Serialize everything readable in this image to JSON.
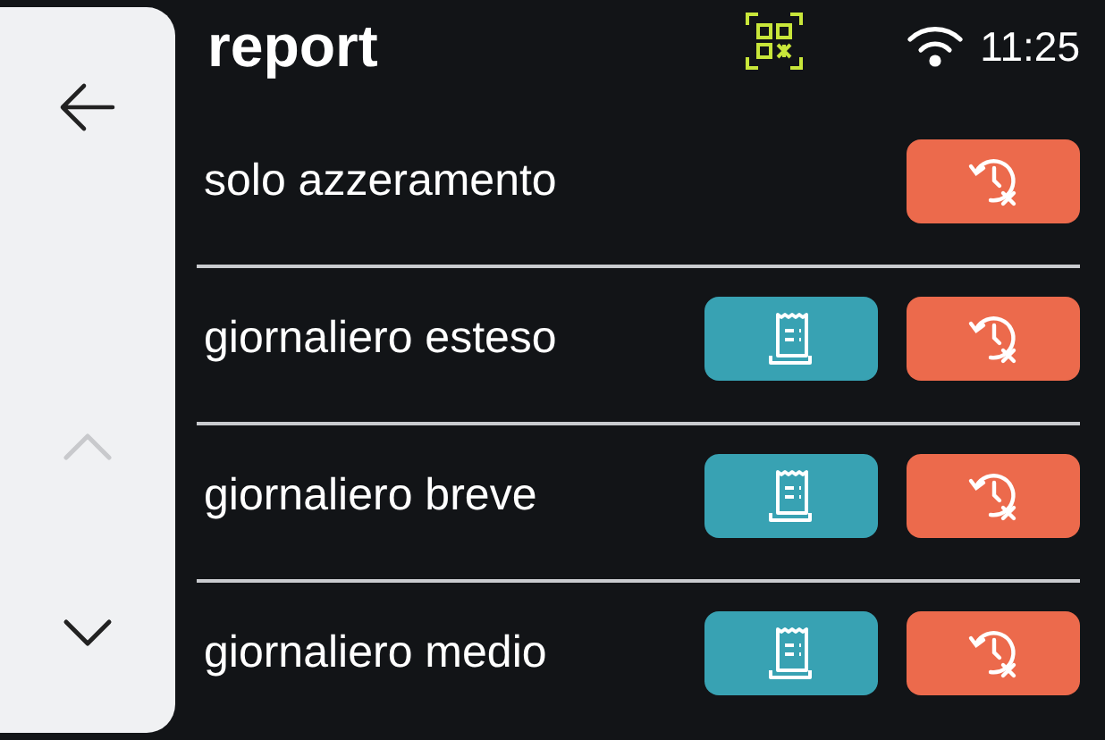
{
  "sidebar": {
    "scroll_up": {
      "disabled": true
    },
    "scroll_down": {
      "disabled": false
    }
  },
  "header": {
    "title": "report",
    "time": "11:25"
  },
  "rows": [
    {
      "label": "solo azzeramento",
      "buttons": [
        {
          "kind": "reset"
        }
      ]
    },
    {
      "label": "giornaliero esteso",
      "buttons": [
        {
          "kind": "print"
        },
        {
          "kind": "reset"
        }
      ]
    },
    {
      "label": "giornaliero breve",
      "buttons": [
        {
          "kind": "print"
        },
        {
          "kind": "reset"
        }
      ]
    },
    {
      "label": "giornaliero medio",
      "buttons": [
        {
          "kind": "print"
        },
        {
          "kind": "reset"
        }
      ]
    }
  ]
}
